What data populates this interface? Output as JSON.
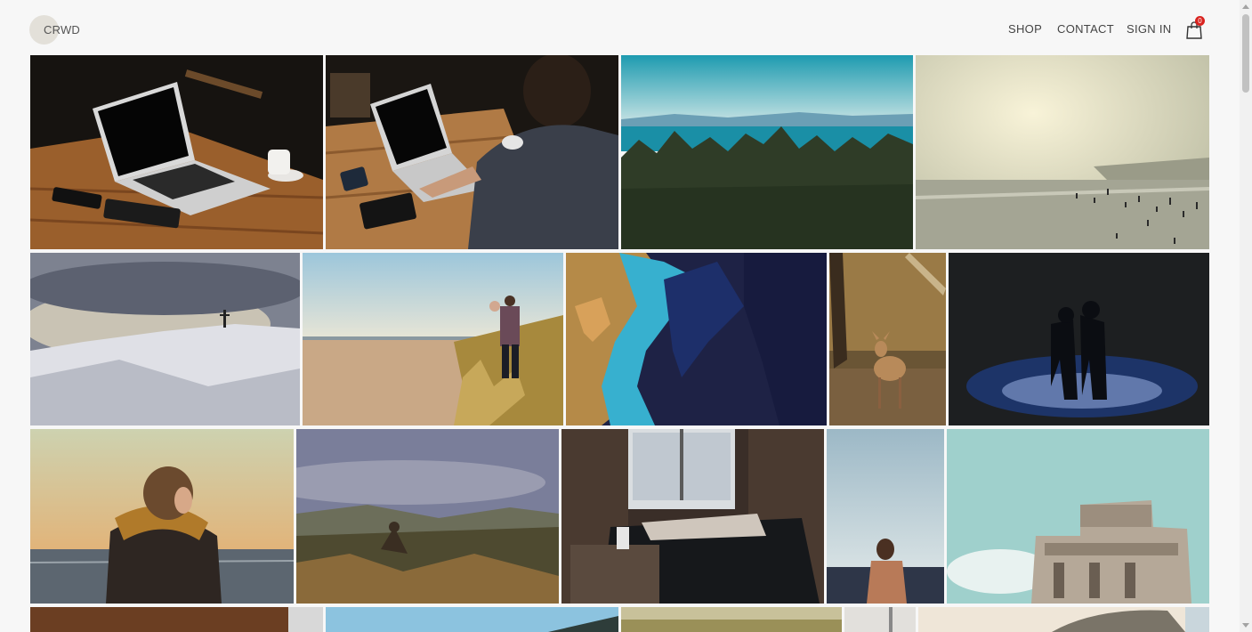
{
  "header": {
    "logo": "CRWD",
    "nav": {
      "shop": "SHOP",
      "contact": "CONTACT",
      "sign_in": "SIGN IN"
    },
    "cart": {
      "icon": "shopping-bag-icon",
      "count": "0"
    }
  },
  "gallery": {
    "photos": [
      "laptop-on-wooden-table",
      "person-typing-on-laptop",
      "forest-overlooking-lake",
      "hazy-crowded-beach",
      "snowy-hill-with-cross",
      "father-carrying-child-on-beach",
      "aerial-coastline",
      "young-deer-in-forest",
      "couple-kissing-at-night",
      "woman-with-scarf-by-sea",
      "person-sitting-on-rocky-hill",
      "person-sleeping-on-couch",
      "shirtless-man-by-shore",
      "concrete-bunker-building",
      "wooden-interior",
      "blue-sky-landscape",
      "dry-grass-field",
      "light-interior",
      "car-mirror"
    ]
  },
  "colors": {
    "background": "#f7f7f7",
    "text": "#444444",
    "badge": "#d9231f"
  }
}
